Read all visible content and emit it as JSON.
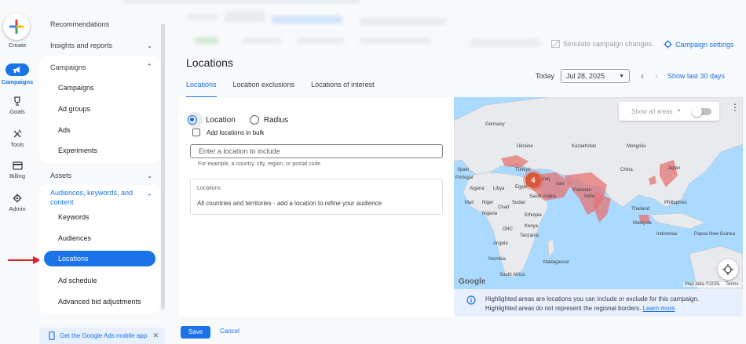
{
  "rail": {
    "create": "Create",
    "campaigns": "Campaigns",
    "goals": "Goals",
    "tools": "Tools",
    "billing": "Billing",
    "admin": "Admin"
  },
  "sidebar": {
    "recommendations": "Recommendations",
    "insights": "Insights and reports",
    "campaigns_header": "Campaigns",
    "campaigns_items": [
      "Campaigns",
      "Ad groups",
      "Ads",
      "Experiments"
    ],
    "assets": "Assets",
    "audiences_header": "Audiences, keywords, and content",
    "audiences_items": [
      "Keywords",
      "Audiences",
      "Locations",
      "Ad schedule",
      "Advanced bid adjustments"
    ],
    "mobile_app": "Get the Google Ads mobile app"
  },
  "toolbar": {
    "simulate": "Simulate campaign changes",
    "campaign_settings": "Campaign settings"
  },
  "page": {
    "title": "Locations",
    "tabs": [
      "Locations",
      "Location exclusions",
      "Locations of interest"
    ]
  },
  "date": {
    "today": "Today",
    "value": "Jul 28, 2025",
    "show_last": "Show last 30 days"
  },
  "form": {
    "radio_location": "Location",
    "radio_radius": "Radius",
    "bulk": "Add locations in bulk",
    "input_placeholder": "Enter a location to include",
    "helper": "For example, a country, city, region, or postal code",
    "box_label": "Locations",
    "box_text": "All countries and territories - add a location to refine your audience"
  },
  "map": {
    "show_all": "Show all areas",
    "cluster_count": "4",
    "logo": "Google",
    "attribution": "Map data ©2025",
    "terms": "Terms",
    "labels": [
      "Ukraine",
      "Kazakhstan",
      "Mongolia",
      "China",
      "India",
      "Japan",
      "Türkiye",
      "Iraq",
      "Iran",
      "Pakistan",
      "Egypt",
      "Saudi Arabia",
      "Algeria",
      "Libya",
      "Sudan",
      "Mali",
      "Niger",
      "Chad",
      "Nigeria",
      "Ethiopia",
      "Kenya",
      "DRC",
      "Tanzania",
      "Angola",
      "Namibia",
      "South Africa",
      "Madagascar",
      "Thailand",
      "Malaysia",
      "Indonesia",
      "Philippines",
      "Papua New Guinea",
      "Spain",
      "Portugal",
      "Germany"
    ]
  },
  "info": {
    "line1": "Highlighted areas are locations you can include or exclude for this campaign.",
    "line2": "Highlighted areas do not represent the regional borders.",
    "link": "Learn more"
  },
  "footer": {
    "save": "Save",
    "cancel": "Cancel"
  }
}
